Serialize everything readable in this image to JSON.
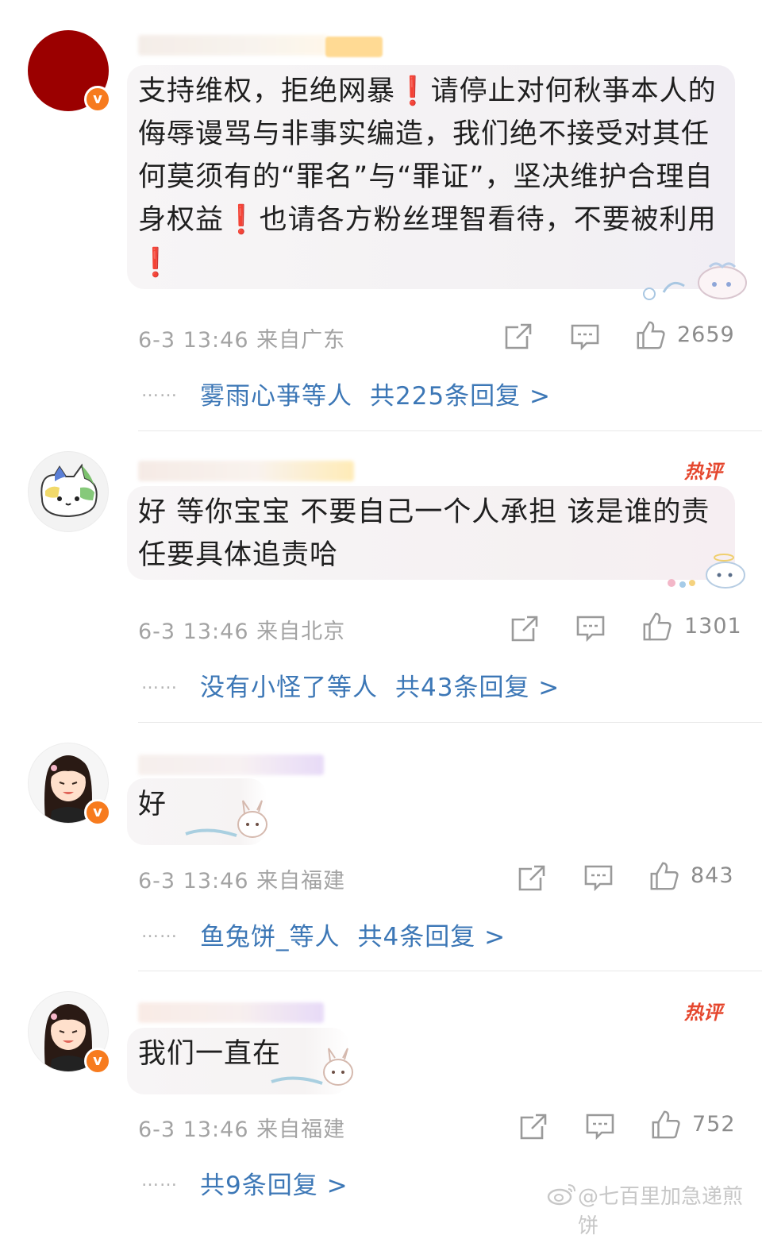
{
  "colors": {
    "link": "#3c77b6",
    "meta": "#a3a3a3",
    "verified_badge": "#f77b1e",
    "hot_badge": "#e5472e"
  },
  "comments": [
    {
      "text": "支持维权，拒绝网暴❗️请停止对何秋亊本人的侮辱谩骂与非事实编造，我们绝不接受对其任何莫须有的“罪名”与“罪证”，坚决维护合理自身权益❗️也请各方粉丝理智看待，不要被利用❗️",
      "time_location": "6-3 13:46 来自广东",
      "likes": "2659",
      "dots": "……",
      "reply_users": "雾雨心亊等人",
      "reply_count": "共225条回复 >",
      "hot_label": "",
      "avatar_icon": "red-avatar",
      "verified": true
    },
    {
      "text": "好 等你宝宝 不要自己一个人承担 该是谁的责任要具体追责哈",
      "time_location": "6-3 13:46 来自北京",
      "likes": "1301",
      "dots": "……",
      "reply_users": "没有小怪了等人",
      "reply_count": "共43条回复 >",
      "hot_label": "热评",
      "avatar_icon": "cat-avatar",
      "verified": false
    },
    {
      "text": "好",
      "time_location": "6-3 13:46 来自福建",
      "likes": "843",
      "dots": "……",
      "reply_users": "鱼兔饼_等人",
      "reply_count": "共4条回复 >",
      "hot_label": "",
      "avatar_icon": "girl-avatar",
      "verified": true
    },
    {
      "text": "我们一直在",
      "time_location": "6-3 13:46 来自福建",
      "likes": "752",
      "dots": "……",
      "reply_users": "",
      "reply_count": "共9条回复 >",
      "hot_label": "热评",
      "avatar_icon": "girl-avatar",
      "verified": true
    }
  ],
  "watermark": "@七百里加急递煎饼",
  "icons": [
    "share-icon",
    "comment-icon",
    "like-icon",
    "weibo-logo-icon",
    "verified-badge-icon"
  ]
}
